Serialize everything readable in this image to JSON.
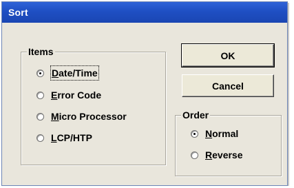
{
  "window": {
    "title": "Sort"
  },
  "items_group": {
    "label": "Items",
    "options": [
      {
        "prefix": "",
        "accel": "D",
        "rest": "ate/Time",
        "checked": true
      },
      {
        "prefix": "",
        "accel": "E",
        "rest": "rror Code",
        "checked": false
      },
      {
        "prefix": "",
        "accel": "M",
        "rest": "icro Processor",
        "checked": false
      },
      {
        "prefix": "",
        "accel": "L",
        "rest": "CP/HTP",
        "checked": false
      }
    ]
  },
  "buttons": {
    "ok": "OK",
    "cancel": "Cancel"
  },
  "order_group": {
    "label": "Order",
    "options": [
      {
        "prefix": "",
        "accel": "N",
        "rest": "ormal",
        "checked": true
      },
      {
        "prefix": "",
        "accel": "R",
        "rest": "everse",
        "checked": false
      }
    ]
  }
}
